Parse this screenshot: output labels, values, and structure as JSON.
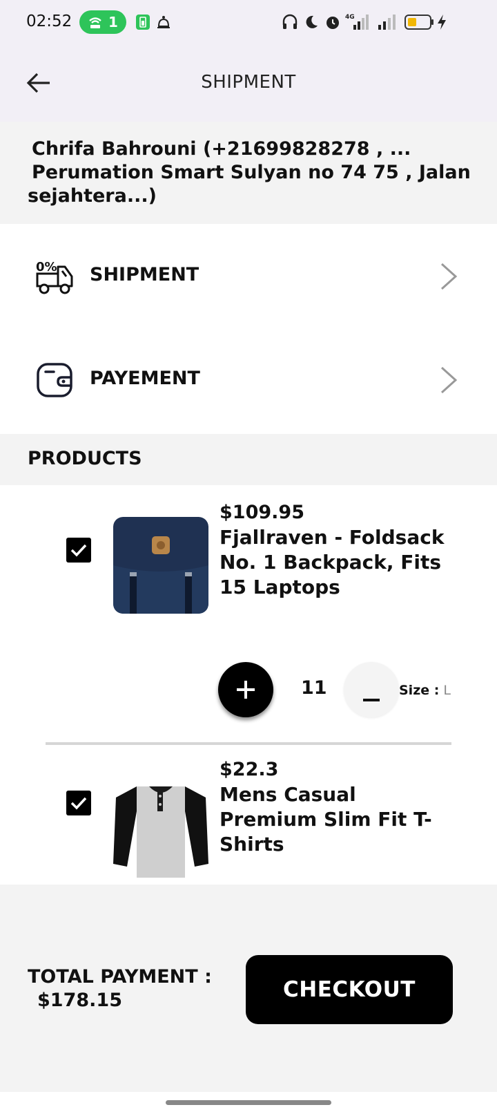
{
  "status_bar": {
    "time": "02:52",
    "hotspot_count": "1",
    "icons": [
      "hotspot-icon",
      "battery-saver-icon",
      "notification-icon",
      "headphones-icon",
      "moon-icon",
      "alarm-icon",
      "signal-4g-icon",
      "signal-icon",
      "battery-icon",
      "charging-icon"
    ],
    "accent_color": "#2ec45a"
  },
  "header": {
    "title": "SHIPMENT",
    "back_icon": "arrow-left-icon"
  },
  "address": {
    "line1": "Chrifa Bahrouni (+21699828278  , ...",
    "line2": "Perumation Smart Sulyan no 74 75 , Jalan",
    "line3": "sejahtera...)"
  },
  "menu": {
    "shipment": {
      "label": "SHIPMENT",
      "icon": "delivery-truck-icon"
    },
    "payment": {
      "label": "PAYEMENT",
      "icon": "wallet-icon"
    }
  },
  "products": {
    "title": "PRODUCTS",
    "items": [
      {
        "checked": true,
        "price": "$109.95",
        "title": "Fjallraven - Foldsack No. 1 Backpack, Fits 15 Laptops",
        "quantity": "11",
        "size_label": "Size :",
        "size_value": "L"
      },
      {
        "checked": true,
        "price": "$22.3",
        "title": "Mens Casual Premium Slim Fit T-Shirts"
      }
    ]
  },
  "footer": {
    "total_label": "TOTAL PAYMENT :",
    "total_value": "$178.15",
    "checkout_label": "CHECKOUT"
  }
}
